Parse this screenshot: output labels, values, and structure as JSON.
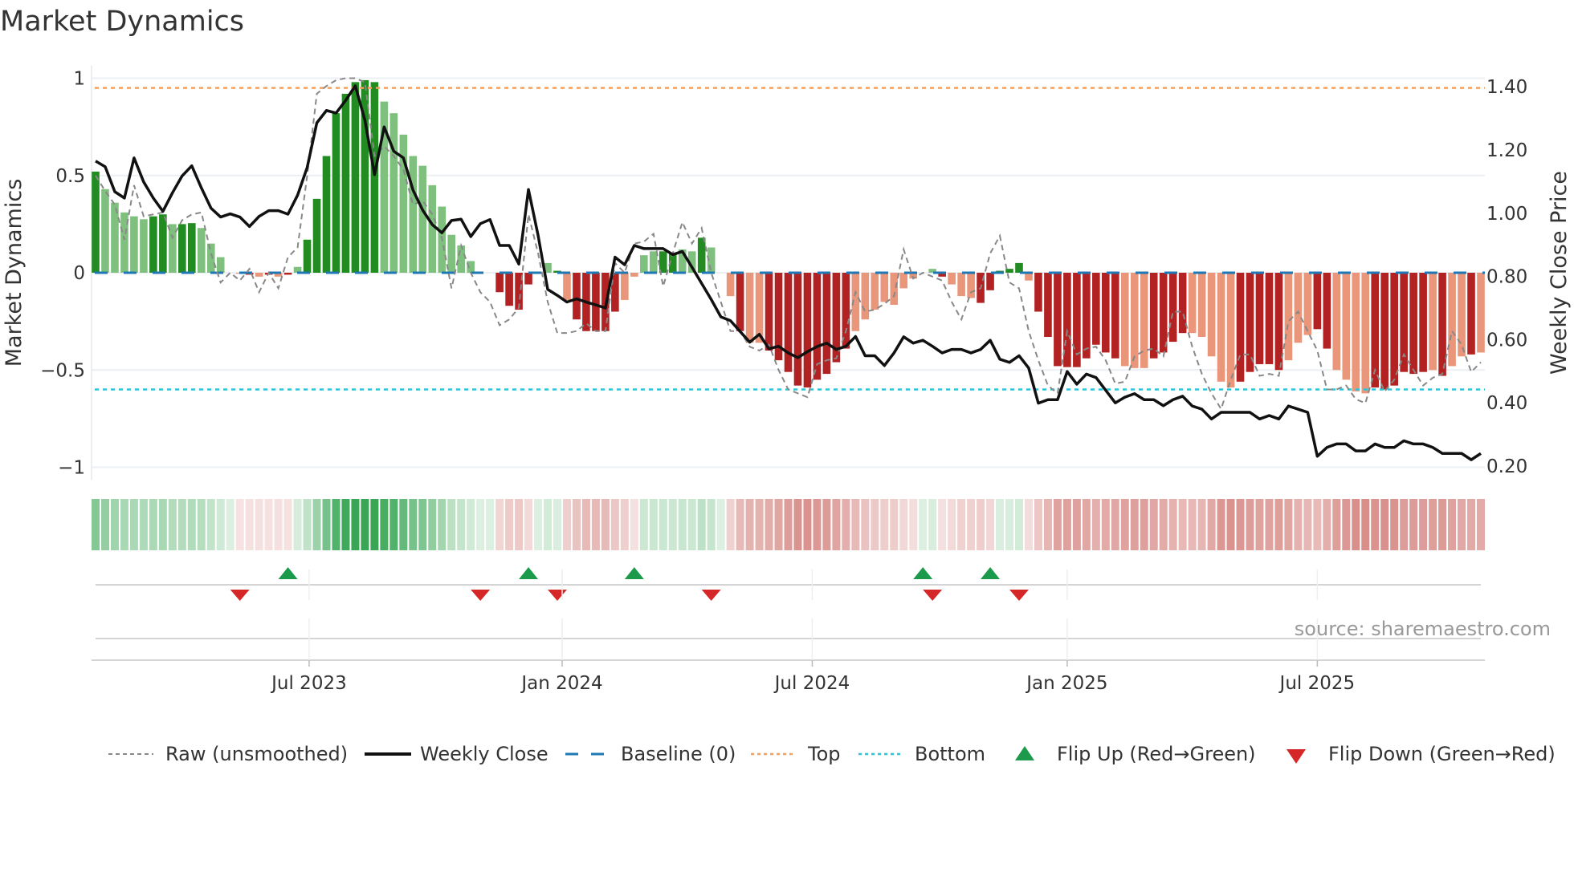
{
  "chart_data": {
    "type": "bar",
    "title": "Market Dynamics",
    "ylabel": "Market Dynamics",
    "y2label": "Weekly Close Price",
    "ylim": [
      -1.05,
      1.05
    ],
    "y2lim": [
      0.2,
      1.4
    ],
    "yticks": [
      {
        "v": 1,
        "label": "1"
      },
      {
        "v": 0.5,
        "label": "0.5"
      },
      {
        "v": 0,
        "label": "0"
      },
      {
        "v": -0.5,
        "label": "−0.5"
      },
      {
        "v": -1,
        "label": "−1"
      }
    ],
    "y2ticks": [
      {
        "v": 1.4,
        "label": "1.40"
      },
      {
        "v": 1.2,
        "label": "1.20"
      },
      {
        "v": 1.0,
        "label": "1.00"
      },
      {
        "v": 0.8,
        "label": "0.80"
      },
      {
        "v": 0.6,
        "label": "0.60"
      },
      {
        "v": 0.4,
        "label": "0.40"
      },
      {
        "v": 0.2,
        "label": "0.20"
      }
    ],
    "xticks": [
      {
        "week": 23.2,
        "label": "Jul 2023"
      },
      {
        "week": 49.5,
        "label": "Jan 2024"
      },
      {
        "week": 75.5,
        "label": "Jul 2024"
      },
      {
        "week": 102,
        "label": "Jan 2025"
      },
      {
        "week": 128,
        "label": "Jul 2025"
      }
    ],
    "grid": true,
    "frequency": "weekly",
    "top_level": 0.95,
    "bottom_level": -0.6,
    "baseline": 0,
    "dynamics": [
      0.52,
      0.43,
      0.36,
      0.31,
      0.29,
      0.275,
      0.29,
      0.3,
      0.25,
      0.25,
      0.255,
      0.23,
      0.15,
      0.08,
      0,
      -0.005,
      -0.01,
      -0.02,
      -0.01,
      -0.02,
      -0.01,
      0.03,
      0.17,
      0.38,
      0.6,
      0.82,
      0.92,
      0.98,
      0.99,
      0.98,
      0.88,
      0.82,
      0.71,
      0.6,
      0.55,
      0.45,
      0.34,
      0.195,
      0.14,
      0.06,
      0,
      0,
      -0.1,
      -0.17,
      -0.19,
      -0.06,
      0,
      0.05,
      0.01,
      -0.14,
      -0.24,
      -0.3,
      -0.3,
      -0.3,
      -0.2,
      -0.14,
      -0.02,
      0.09,
      0.11,
      0.11,
      0.1,
      0.12,
      0.11,
      0.18,
      0.13,
      0,
      -0.12,
      -0.3,
      -0.36,
      -0.36,
      -0.4,
      -0.45,
      -0.51,
      -0.58,
      -0.59,
      -0.55,
      -0.52,
      -0.46,
      -0.39,
      -0.3,
      -0.24,
      -0.19,
      -0.15,
      -0.165,
      -0.08,
      -0.03,
      0,
      0.02,
      -0.02,
      -0.06,
      -0.12,
      -0.13,
      -0.155,
      -0.09,
      0.01,
      0.02,
      0.05,
      -0.04,
      -0.2,
      -0.33,
      -0.48,
      -0.485,
      -0.485,
      -0.44,
      -0.37,
      -0.41,
      -0.44,
      -0.48,
      -0.49,
      -0.49,
      -0.44,
      -0.41,
      -0.355,
      -0.31,
      -0.31,
      -0.33,
      -0.43,
      -0.56,
      -0.59,
      -0.56,
      -0.51,
      -0.47,
      -0.47,
      -0.5,
      -0.45,
      -0.36,
      -0.32,
      -0.29,
      -0.39,
      -0.5,
      -0.55,
      -0.61,
      -0.62,
      -0.59,
      -0.6,
      -0.58,
      -0.51,
      -0.52,
      -0.51,
      -0.5,
      -0.53,
      -0.48,
      -0.43,
      -0.42,
      -0.41
    ],
    "shade": "dlllllddlddllllldldldlddddddddllllllllllllddddlldldddddlllldd lldldldlldddddddddllllllllldllldddddldddddddddlllddddlllllddddd llldd llllddddddldlldlldllll",
    "raw": [
      0.5,
      0.42,
      0.35,
      0.17,
      0.45,
      0.29,
      0.3,
      0.31,
      0.18,
      0.27,
      0.3,
      0.31,
      0.1,
      -0.05,
      0.0,
      -0.04,
      0.02,
      -0.1,
      0.0,
      -0.08,
      0.08,
      0.13,
      0.5,
      0.92,
      0.96,
      0.99,
      1.0,
      1.0,
      0.98,
      0.6,
      0.65,
      0.6,
      0.53,
      0.35,
      0.37,
      0.3,
      0.18,
      -0.08,
      0.14,
      0.0,
      -0.1,
      -0.15,
      -0.27,
      -0.24,
      -0.18,
      0.3,
      0.1,
      -0.15,
      -0.31,
      -0.31,
      -0.3,
      -0.26,
      -0.3,
      -0.3,
      0.05,
      0.0,
      0.15,
      0.16,
      0.2,
      -0.07,
      0.1,
      0.26,
      0.15,
      0.23,
      0.0,
      -0.15,
      -0.3,
      -0.3,
      -0.38,
      -0.4,
      -0.37,
      -0.5,
      -0.6,
      -0.62,
      -0.64,
      -0.47,
      -0.45,
      -0.44,
      -0.3,
      -0.1,
      -0.2,
      -0.19,
      -0.16,
      -0.12,
      0.12,
      -0.03,
      0.0,
      -0.02,
      -0.04,
      -0.15,
      -0.24,
      -0.1,
      -0.08,
      0.1,
      0.19,
      -0.05,
      -0.08,
      -0.3,
      -0.45,
      -0.58,
      -0.62,
      -0.3,
      -0.42,
      -0.39,
      -0.38,
      -0.45,
      -0.57,
      -0.56,
      -0.43,
      -0.4,
      -0.39,
      -0.43,
      -0.2,
      -0.2,
      -0.38,
      -0.52,
      -0.62,
      -0.7,
      -0.55,
      -0.42,
      -0.42,
      -0.53,
      -0.52,
      -0.53,
      -0.25,
      -0.2,
      -0.3,
      -0.4,
      -0.6,
      -0.6,
      -0.58,
      -0.65,
      -0.67,
      -0.5,
      -0.61,
      -0.55,
      -0.42,
      -0.5,
      -0.58,
      -0.54,
      -0.52,
      -0.3,
      -0.37,
      -0.51,
      -0.46
    ],
    "close": [
      1.165,
      1.147,
      1.068,
      1.048,
      1.175,
      1.099,
      1.048,
      1.006,
      1.065,
      1.118,
      1.15,
      1.08,
      1.016,
      0.988,
      0.998,
      0.988,
      0.958,
      0.99,
      1.008,
      1.008,
      0.997,
      1.057,
      1.145,
      1.286,
      1.325,
      1.317,
      1.357,
      1.403,
      1.294,
      1.122,
      1.273,
      1.196,
      1.175,
      1.073,
      1.01,
      0.964,
      0.938,
      0.977,
      0.981,
      0.926,
      0.967,
      0.98,
      0.898,
      0.898,
      0.839,
      1.075,
      0.93,
      0.759,
      0.74,
      0.719,
      0.729,
      0.719,
      0.71,
      0.7,
      0.861,
      0.837,
      0.898,
      0.888,
      0.888,
      0.888,
      0.869,
      0.879,
      0.829,
      0.778,
      0.727,
      0.672,
      0.66,
      0.626,
      0.592,
      0.617,
      0.571,
      0.579,
      0.558,
      0.543,
      0.562,
      0.578,
      0.589,
      0.569,
      0.579,
      0.61,
      0.549,
      0.549,
      0.518,
      0.558,
      0.609,
      0.589,
      0.598,
      0.579,
      0.558,
      0.569,
      0.569,
      0.558,
      0.569,
      0.598,
      0.538,
      0.528,
      0.549,
      0.51,
      0.399,
      0.41,
      0.41,
      0.499,
      0.459,
      0.491,
      0.48,
      0.44,
      0.4,
      0.418,
      0.429,
      0.41,
      0.41,
      0.391,
      0.41,
      0.421,
      0.39,
      0.38,
      0.349,
      0.37,
      0.37,
      0.37,
      0.37,
      0.349,
      0.36,
      0.349,
      0.39,
      0.38,
      0.37,
      0.231,
      0.259,
      0.27,
      0.27,
      0.248,
      0.248,
      0.27,
      0.259,
      0.259,
      0.28,
      0.27,
      0.27,
      0.259,
      0.24,
      0.24,
      0.24,
      0.22,
      0.24
    ],
    "flips": [
      {
        "week": 16,
        "dir": "down"
      },
      {
        "week": 21,
        "dir": "up"
      },
      {
        "week": 41,
        "dir": "down"
      },
      {
        "week": 46,
        "dir": "up"
      },
      {
        "week": 49,
        "dir": "down"
      },
      {
        "week": 57,
        "dir": "up"
      },
      {
        "week": 65,
        "dir": "down"
      },
      {
        "week": 87,
        "dir": "up"
      },
      {
        "week": 88,
        "dir": "down"
      },
      {
        "week": 94,
        "dir": "up"
      },
      {
        "week": 97,
        "dir": "down"
      }
    ],
    "legend": {
      "placement": "bottom",
      "raw": "Raw (unsmoothed)",
      "close": "Weekly Close",
      "baseline": "Baseline (0)",
      "top": "Top",
      "bottom": "Bottom",
      "flip_up": "Flip Up (Red→Green)",
      "flip_down": "Flip Down (Green→Red)"
    },
    "source": "source: sharemaestro.com"
  },
  "colors": {
    "dark_green": "#228b22",
    "light_green": "#7fc07f",
    "dark_red": "#b22222",
    "light_red": "#e9967a",
    "baseline": "#1f77b4",
    "top": "#f0a060",
    "bottom": "#2ec4d6",
    "raw": "#888888",
    "close": "#111111",
    "flip_up": "#1a9a4a",
    "flip_down": "#d62728"
  }
}
